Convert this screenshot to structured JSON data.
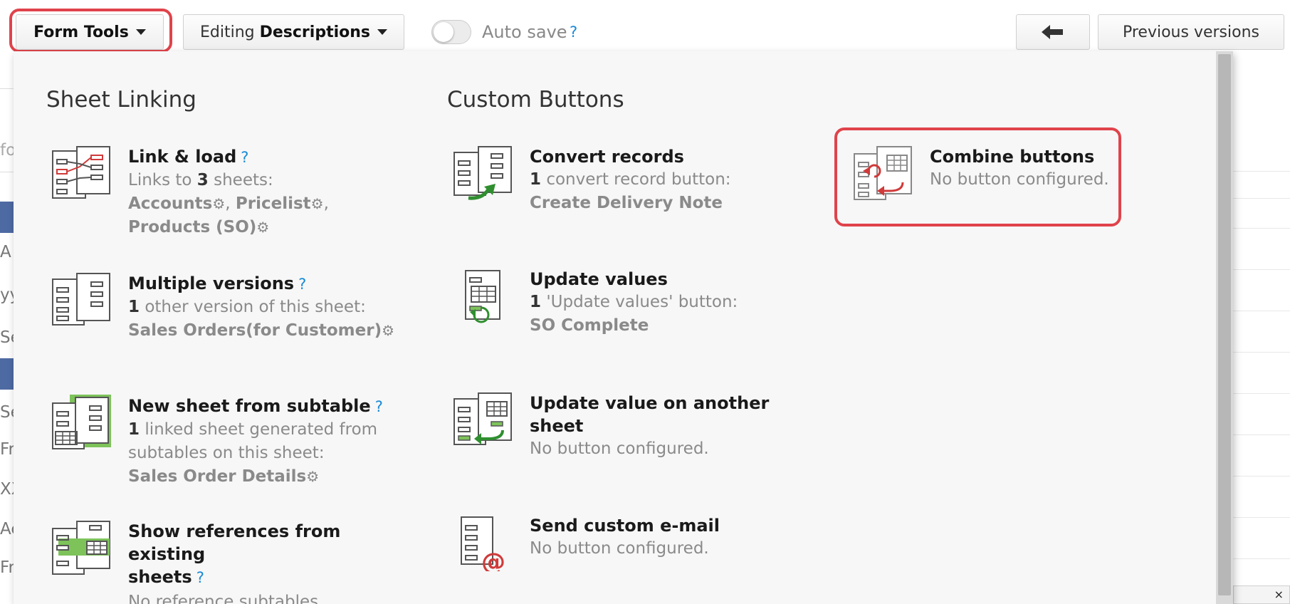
{
  "toolbar": {
    "form_tools_label": "Form Tools",
    "editing_prefix": "Editing",
    "editing_value": "Descriptions",
    "autosave_label": "Auto save",
    "autosave_help": "?",
    "back_icon": "←",
    "previous_versions_label": "Previous versions"
  },
  "background": {
    "fragments": [
      "fo",
      "A",
      "yy",
      "Se",
      "Se",
      "Fr",
      "XX",
      "Ac",
      "Fr"
    ],
    "close_glyph": "×"
  },
  "panel": {
    "sheet_linking": {
      "title": "Sheet Linking",
      "items": [
        {
          "title": "Link & load",
          "help": "?",
          "desc_pre": "Links to ",
          "desc_count": "3",
          "desc_post": " sheets:",
          "links": [
            "Accounts",
            "Pricelist",
            "Products (SO)"
          ]
        },
        {
          "title": "Multiple versions",
          "help": "?",
          "desc_count": "1",
          "desc_post": " other version of this sheet:",
          "links": [
            "Sales Orders(for Customer)"
          ]
        },
        {
          "title": "New sheet from subtable",
          "help": "?",
          "desc_count": "1",
          "desc_post": " linked sheet generated from",
          "desc_line2": "subtables on this sheet:",
          "links": [
            "Sales Order Details"
          ]
        },
        {
          "title_line1": "Show references from existing",
          "title_line2": "sheets",
          "help": "?",
          "desc": "No reference subtables."
        }
      ]
    },
    "custom_buttons": {
      "title": "Custom Buttons",
      "items": [
        {
          "title": "Convert records",
          "desc_count": "1",
          "desc_post": " convert record button:",
          "link": "Create Delivery Note"
        },
        {
          "title": "Update values",
          "desc_count": "1",
          "desc_post": " 'Update values' button:",
          "link": "SO Complete"
        },
        {
          "title": "Update value on another sheet",
          "desc": "No button configured."
        },
        {
          "title": "Send custom e-mail",
          "desc": "No button configured."
        },
        {
          "title": "Combine buttons",
          "desc": "No button configured."
        }
      ]
    },
    "gear_glyph": "⚙"
  },
  "colors": {
    "highlight": "#e0434b",
    "help": "#1a8ad6",
    "green_accent": "#7dc35a",
    "red_accent": "#d03a3a"
  }
}
